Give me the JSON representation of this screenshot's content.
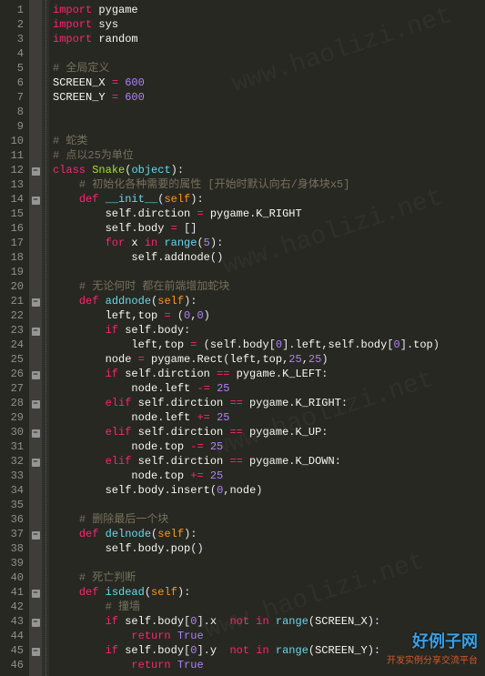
{
  "watermark": {
    "big": "好例子网",
    "small": "开发实例分享交流平台",
    "bg": "www.haolizi.net"
  },
  "fold_marks": {
    "12": true,
    "14": true,
    "21": true,
    "23": true,
    "26": true,
    "28": true,
    "30": true,
    "32": true,
    "37": true,
    "41": true,
    "43": true,
    "45": true
  },
  "lines": [
    {
      "n": 1,
      "t": [
        [
          "kw",
          "import"
        ],
        [
          "nm",
          " pygame"
        ]
      ]
    },
    {
      "n": 2,
      "t": [
        [
          "kw",
          "import"
        ],
        [
          "nm",
          " sys"
        ]
      ]
    },
    {
      "n": 3,
      "t": [
        [
          "kw",
          "import"
        ],
        [
          "nm",
          " random"
        ]
      ]
    },
    {
      "n": 4,
      "t": []
    },
    {
      "n": 5,
      "t": [
        [
          "cm",
          "# 全局定义"
        ]
      ]
    },
    {
      "n": 6,
      "t": [
        [
          "nm",
          "SCREEN_X "
        ],
        [
          "op",
          "="
        ],
        [
          "nm",
          " "
        ],
        [
          "num",
          "600"
        ]
      ]
    },
    {
      "n": 7,
      "t": [
        [
          "nm",
          "SCREEN_Y "
        ],
        [
          "op",
          "="
        ],
        [
          "nm",
          " "
        ],
        [
          "num",
          "600"
        ]
      ]
    },
    {
      "n": 8,
      "t": []
    },
    {
      "n": 9,
      "t": []
    },
    {
      "n": 10,
      "t": [
        [
          "cm",
          "# 蛇类"
        ]
      ]
    },
    {
      "n": 11,
      "t": [
        [
          "cm",
          "# 点以25为单位"
        ]
      ]
    },
    {
      "n": 12,
      "t": [
        [
          "kw",
          "class"
        ],
        [
          "nm",
          " "
        ],
        [
          "cls",
          "Snake"
        ],
        [
          "pn",
          "("
        ],
        [
          "fn",
          "object"
        ],
        [
          "pn",
          ")"
        ],
        [
          "pn",
          ":"
        ]
      ]
    },
    {
      "n": 13,
      "i": 1,
      "t": [
        [
          "cm",
          "# 初始化各种需要的属性 [开始时默认向右/身体块x5]"
        ]
      ]
    },
    {
      "n": 14,
      "i": 1,
      "t": [
        [
          "kw",
          "def"
        ],
        [
          "nm",
          " "
        ],
        [
          "fn",
          "__init__"
        ],
        [
          "pn",
          "("
        ],
        [
          "par",
          "self"
        ],
        [
          "pn",
          ")"
        ],
        [
          "pn",
          ":"
        ]
      ]
    },
    {
      "n": 15,
      "i": 2,
      "t": [
        [
          "nm",
          "self"
        ],
        [
          "pn",
          "."
        ],
        [
          "nm",
          "dirction "
        ],
        [
          "op",
          "="
        ],
        [
          "nm",
          " pygame"
        ],
        [
          "pn",
          "."
        ],
        [
          "nm",
          "K_RIGHT"
        ]
      ]
    },
    {
      "n": 16,
      "i": 2,
      "t": [
        [
          "nm",
          "self"
        ],
        [
          "pn",
          "."
        ],
        [
          "nm",
          "body "
        ],
        [
          "op",
          "="
        ],
        [
          "nm",
          " "
        ],
        [
          "pn",
          "["
        ],
        [
          "pn",
          "]"
        ]
      ]
    },
    {
      "n": 17,
      "i": 2,
      "t": [
        [
          "kw",
          "for"
        ],
        [
          "nm",
          " x "
        ],
        [
          "kw",
          "in"
        ],
        [
          "nm",
          " "
        ],
        [
          "fn",
          "range"
        ],
        [
          "pn",
          "("
        ],
        [
          "num",
          "5"
        ],
        [
          "pn",
          ")"
        ],
        [
          "pn",
          ":"
        ]
      ]
    },
    {
      "n": 18,
      "i": 3,
      "t": [
        [
          "nm",
          "self"
        ],
        [
          "pn",
          "."
        ],
        [
          "nm",
          "addnode"
        ],
        [
          "pn",
          "("
        ],
        [
          "pn",
          ")"
        ]
      ]
    },
    {
      "n": 19,
      "t": []
    },
    {
      "n": 20,
      "i": 1,
      "t": [
        [
          "cm",
          "# 无论何时 都在前端增加蛇块"
        ]
      ]
    },
    {
      "n": 21,
      "i": 1,
      "t": [
        [
          "kw",
          "def"
        ],
        [
          "nm",
          " "
        ],
        [
          "fn",
          "addnode"
        ],
        [
          "pn",
          "("
        ],
        [
          "par",
          "self"
        ],
        [
          "pn",
          ")"
        ],
        [
          "pn",
          ":"
        ]
      ]
    },
    {
      "n": 22,
      "i": 2,
      "t": [
        [
          "nm",
          "left"
        ],
        [
          "pn",
          ","
        ],
        [
          "nm",
          "top "
        ],
        [
          "op",
          "="
        ],
        [
          "nm",
          " "
        ],
        [
          "pn",
          "("
        ],
        [
          "num",
          "0"
        ],
        [
          "pn",
          ","
        ],
        [
          "num",
          "0"
        ],
        [
          "pn",
          ")"
        ]
      ]
    },
    {
      "n": 23,
      "i": 2,
      "t": [
        [
          "kw",
          "if"
        ],
        [
          "nm",
          " self"
        ],
        [
          "pn",
          "."
        ],
        [
          "nm",
          "body"
        ],
        [
          "pn",
          ":"
        ]
      ]
    },
    {
      "n": 24,
      "i": 3,
      "t": [
        [
          "nm",
          "left"
        ],
        [
          "pn",
          ","
        ],
        [
          "nm",
          "top "
        ],
        [
          "op",
          "="
        ],
        [
          "nm",
          " "
        ],
        [
          "pn",
          "("
        ],
        [
          "nm",
          "self"
        ],
        [
          "pn",
          "."
        ],
        [
          "nm",
          "body"
        ],
        [
          "pn",
          "["
        ],
        [
          "num",
          "0"
        ],
        [
          "pn",
          "]"
        ],
        [
          "pn",
          "."
        ],
        [
          "nm",
          "left"
        ],
        [
          "pn",
          ","
        ],
        [
          "nm",
          "self"
        ],
        [
          "pn",
          "."
        ],
        [
          "nm",
          "body"
        ],
        [
          "pn",
          "["
        ],
        [
          "num",
          "0"
        ],
        [
          "pn",
          "]"
        ],
        [
          "pn",
          "."
        ],
        [
          "nm",
          "top"
        ],
        [
          "pn",
          ")"
        ]
      ]
    },
    {
      "n": 25,
      "i": 2,
      "t": [
        [
          "nm",
          "node "
        ],
        [
          "op",
          "="
        ],
        [
          "nm",
          " pygame"
        ],
        [
          "pn",
          "."
        ],
        [
          "nm",
          "Rect"
        ],
        [
          "pn",
          "("
        ],
        [
          "nm",
          "left"
        ],
        [
          "pn",
          ","
        ],
        [
          "nm",
          "top"
        ],
        [
          "pn",
          ","
        ],
        [
          "num",
          "25"
        ],
        [
          "pn",
          ","
        ],
        [
          "num",
          "25"
        ],
        [
          "pn",
          ")"
        ]
      ]
    },
    {
      "n": 26,
      "i": 2,
      "t": [
        [
          "kw",
          "if"
        ],
        [
          "nm",
          " self"
        ],
        [
          "pn",
          "."
        ],
        [
          "nm",
          "dirction "
        ],
        [
          "op",
          "=="
        ],
        [
          "nm",
          " pygame"
        ],
        [
          "pn",
          "."
        ],
        [
          "nm",
          "K_LEFT"
        ],
        [
          "pn",
          ":"
        ]
      ]
    },
    {
      "n": 27,
      "i": 3,
      "t": [
        [
          "nm",
          "node"
        ],
        [
          "pn",
          "."
        ],
        [
          "nm",
          "left "
        ],
        [
          "op",
          "-="
        ],
        [
          "nm",
          " "
        ],
        [
          "num",
          "25"
        ]
      ]
    },
    {
      "n": 28,
      "i": 2,
      "t": [
        [
          "kw",
          "elif"
        ],
        [
          "nm",
          " self"
        ],
        [
          "pn",
          "."
        ],
        [
          "nm",
          "dirction "
        ],
        [
          "op",
          "=="
        ],
        [
          "nm",
          " pygame"
        ],
        [
          "pn",
          "."
        ],
        [
          "nm",
          "K_RIGHT"
        ],
        [
          "pn",
          ":"
        ]
      ]
    },
    {
      "n": 29,
      "i": 3,
      "t": [
        [
          "nm",
          "node"
        ],
        [
          "pn",
          "."
        ],
        [
          "nm",
          "left "
        ],
        [
          "op",
          "+="
        ],
        [
          "nm",
          " "
        ],
        [
          "num",
          "25"
        ]
      ]
    },
    {
      "n": 30,
      "i": 2,
      "t": [
        [
          "kw",
          "elif"
        ],
        [
          "nm",
          " self"
        ],
        [
          "pn",
          "."
        ],
        [
          "nm",
          "dirction "
        ],
        [
          "op",
          "=="
        ],
        [
          "nm",
          " pygame"
        ],
        [
          "pn",
          "."
        ],
        [
          "nm",
          "K_UP"
        ],
        [
          "pn",
          ":"
        ]
      ]
    },
    {
      "n": 31,
      "i": 3,
      "t": [
        [
          "nm",
          "node"
        ],
        [
          "pn",
          "."
        ],
        [
          "nm",
          "top "
        ],
        [
          "op",
          "-="
        ],
        [
          "nm",
          " "
        ],
        [
          "num",
          "25"
        ]
      ]
    },
    {
      "n": 32,
      "i": 2,
      "t": [
        [
          "kw",
          "elif"
        ],
        [
          "nm",
          " self"
        ],
        [
          "pn",
          "."
        ],
        [
          "nm",
          "dirction "
        ],
        [
          "op",
          "=="
        ],
        [
          "nm",
          " pygame"
        ],
        [
          "pn",
          "."
        ],
        [
          "nm",
          "K_DOWN"
        ],
        [
          "pn",
          ":"
        ]
      ]
    },
    {
      "n": 33,
      "i": 3,
      "t": [
        [
          "nm",
          "node"
        ],
        [
          "pn",
          "."
        ],
        [
          "nm",
          "top "
        ],
        [
          "op",
          "+="
        ],
        [
          "nm",
          " "
        ],
        [
          "num",
          "25"
        ]
      ]
    },
    {
      "n": 34,
      "i": 2,
      "t": [
        [
          "nm",
          "self"
        ],
        [
          "pn",
          "."
        ],
        [
          "nm",
          "body"
        ],
        [
          "pn",
          "."
        ],
        [
          "nm",
          "insert"
        ],
        [
          "pn",
          "("
        ],
        [
          "num",
          "0"
        ],
        [
          "pn",
          ","
        ],
        [
          "nm",
          "node"
        ],
        [
          "pn",
          ")"
        ]
      ]
    },
    {
      "n": 35,
      "t": []
    },
    {
      "n": 36,
      "i": 1,
      "t": [
        [
          "cm",
          "# 删除最后一个块"
        ]
      ]
    },
    {
      "n": 37,
      "i": 1,
      "t": [
        [
          "kw",
          "def"
        ],
        [
          "nm",
          " "
        ],
        [
          "fn",
          "delnode"
        ],
        [
          "pn",
          "("
        ],
        [
          "par",
          "self"
        ],
        [
          "pn",
          ")"
        ],
        [
          "pn",
          ":"
        ]
      ]
    },
    {
      "n": 38,
      "i": 2,
      "t": [
        [
          "nm",
          "self"
        ],
        [
          "pn",
          "."
        ],
        [
          "nm",
          "body"
        ],
        [
          "pn",
          "."
        ],
        [
          "nm",
          "pop"
        ],
        [
          "pn",
          "("
        ],
        [
          "pn",
          ")"
        ]
      ]
    },
    {
      "n": 39,
      "t": []
    },
    {
      "n": 40,
      "i": 1,
      "t": [
        [
          "cm",
          "# 死亡判断"
        ]
      ]
    },
    {
      "n": 41,
      "i": 1,
      "t": [
        [
          "kw",
          "def"
        ],
        [
          "nm",
          " "
        ],
        [
          "fn",
          "isdead"
        ],
        [
          "pn",
          "("
        ],
        [
          "par",
          "self"
        ],
        [
          "pn",
          ")"
        ],
        [
          "pn",
          ":"
        ]
      ]
    },
    {
      "n": 42,
      "i": 2,
      "t": [
        [
          "cm",
          "# 撞墙"
        ]
      ]
    },
    {
      "n": 43,
      "i": 2,
      "t": [
        [
          "kw",
          "if"
        ],
        [
          "nm",
          " self"
        ],
        [
          "pn",
          "."
        ],
        [
          "nm",
          "body"
        ],
        [
          "pn",
          "["
        ],
        [
          "num",
          "0"
        ],
        [
          "pn",
          "]"
        ],
        [
          "pn",
          "."
        ],
        [
          "nm",
          "x  "
        ],
        [
          "kw",
          "not"
        ],
        [
          "nm",
          " "
        ],
        [
          "kw",
          "in"
        ],
        [
          "nm",
          " "
        ],
        [
          "fn",
          "range"
        ],
        [
          "pn",
          "("
        ],
        [
          "nm",
          "SCREEN_X"
        ],
        [
          "pn",
          ")"
        ],
        [
          "pn",
          ":"
        ]
      ]
    },
    {
      "n": 44,
      "i": 3,
      "t": [
        [
          "kw",
          "return"
        ],
        [
          "nm",
          " "
        ],
        [
          "bool",
          "True"
        ]
      ]
    },
    {
      "n": 45,
      "i": 2,
      "t": [
        [
          "kw",
          "if"
        ],
        [
          "nm",
          " self"
        ],
        [
          "pn",
          "."
        ],
        [
          "nm",
          "body"
        ],
        [
          "pn",
          "["
        ],
        [
          "num",
          "0"
        ],
        [
          "pn",
          "]"
        ],
        [
          "pn",
          "."
        ],
        [
          "nm",
          "y  "
        ],
        [
          "kw",
          "not"
        ],
        [
          "nm",
          " "
        ],
        [
          "kw",
          "in"
        ],
        [
          "nm",
          " "
        ],
        [
          "fn",
          "range"
        ],
        [
          "pn",
          "("
        ],
        [
          "nm",
          "SCREEN_Y"
        ],
        [
          "pn",
          ")"
        ],
        [
          "pn",
          ":"
        ]
      ]
    },
    {
      "n": 46,
      "i": 3,
      "t": [
        [
          "kw",
          "return"
        ],
        [
          "nm",
          " "
        ],
        [
          "bool",
          "True"
        ]
      ]
    }
  ]
}
